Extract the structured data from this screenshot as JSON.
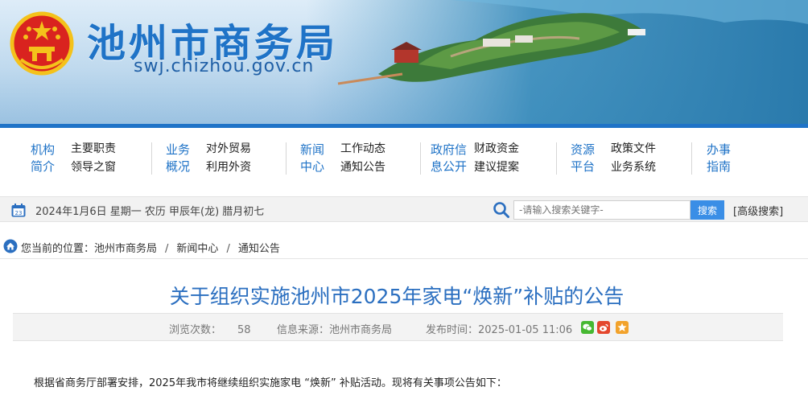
{
  "header": {
    "site_title": "池州市商务局",
    "site_url": "swj.chizhou.gov.cn"
  },
  "nav": [
    {
      "category": [
        "机构",
        "简介"
      ],
      "links": [
        "主要职责",
        "领导之窗"
      ]
    },
    {
      "category": [
        "业务",
        "概况"
      ],
      "links": [
        "对外贸易",
        "利用外资"
      ]
    },
    {
      "category": [
        "新闻",
        "中心"
      ],
      "links": [
        "工作动态",
        "通知公告"
      ]
    },
    {
      "category": [
        "政府信",
        "息公开"
      ],
      "links": [
        "财政资金",
        "建议提案"
      ]
    },
    {
      "category": [
        "资源",
        "平台"
      ],
      "links": [
        "政策文件",
        "业务系统"
      ]
    },
    {
      "category": [
        "办事",
        "指南"
      ],
      "links": []
    }
  ],
  "infobar": {
    "date_text": "2024年1月6日  星期一  农历 甲辰年(龙) 腊月初七",
    "search_placeholder": "-请输入搜索关键字-",
    "search_button": "搜索",
    "advanced_search": "[高级搜索]"
  },
  "breadcrumb": {
    "prefix": "您当前的位置：",
    "items": [
      "池州市商务局",
      "新闻中心",
      "通知公告"
    ]
  },
  "article": {
    "title": "关于组织实施池州市2025年家电“焕新”补贴的公告",
    "views_label": "浏览次数：",
    "views": "58",
    "source_label": "信息来源：",
    "source": "池州市商务局",
    "time_label": "发布时间：",
    "time": "2025-01-05 11:06",
    "first_paragraph": "根据省商务厅部署安排，2025年我市将继续组织实施家电 “焕新” 补贴活动。现将有关事项公告如下："
  },
  "colors": {
    "brand_blue": "#1f73c7",
    "title_blue": "#2b6fc0",
    "wechat": "#46b832",
    "weibo": "#e4462d",
    "qzone": "#f2a22b"
  },
  "icons": [
    "national-emblem-icon",
    "calendar-icon",
    "search-icon",
    "home-icon",
    "wechat-icon",
    "weibo-icon",
    "qzone-icon"
  ]
}
